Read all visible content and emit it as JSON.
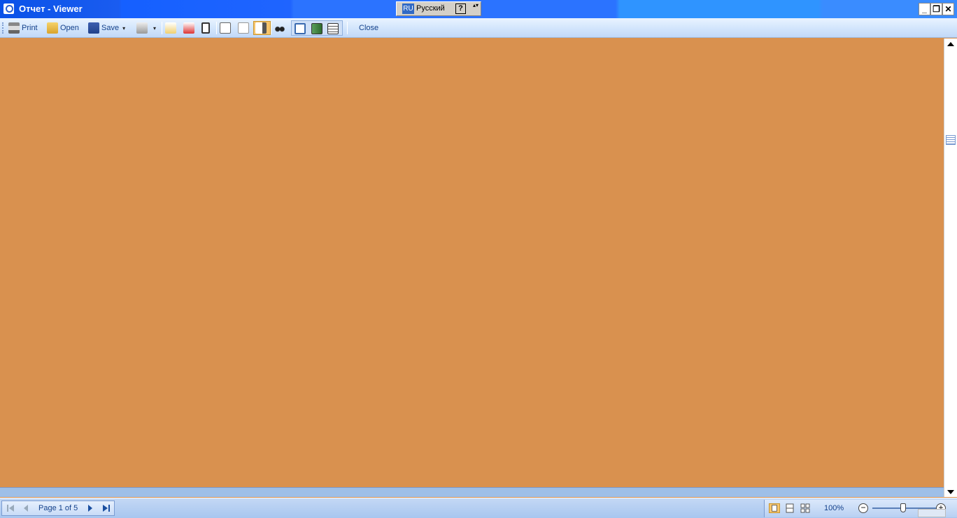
{
  "window": {
    "title": "Отчет - Viewer",
    "minimize_glyph": "_",
    "restore_glyph": "❐",
    "close_glyph": "✕"
  },
  "language_bar": {
    "code": "RU",
    "language": "Русский",
    "help": "?",
    "menu_glyph": "▴▾"
  },
  "toolbar": {
    "print_label": "Print",
    "open_label": "Open",
    "save_label": "Save",
    "dropdown_glyph": "▾",
    "close_label": "Close"
  },
  "statusbar": {
    "page_label": "Page 1 of 5",
    "zoom_label": "100%",
    "zoom_minus": "−",
    "zoom_plus": "+"
  },
  "colors": {
    "canvas": "#d9914f",
    "titlebar": "#2b73ff",
    "toolbar": "#d4e6fc",
    "text": "#15428b"
  },
  "icons": [
    "app-viewer-icon",
    "print-icon",
    "open-folder-icon",
    "save-disk-icon",
    "export-icon",
    "new-page-icon",
    "delete-page-icon",
    "single-page-icon",
    "page-setup-icon",
    "help-icon",
    "thumbnails-icon",
    "find-binoculars-icon",
    "view-normal-icon",
    "view-full-icon",
    "view-print-icon",
    "first-page-icon",
    "prev-page-icon",
    "next-page-icon",
    "last-page-icon",
    "single-page-view-icon",
    "multi-page-view-icon",
    "grid-view-icon"
  ]
}
